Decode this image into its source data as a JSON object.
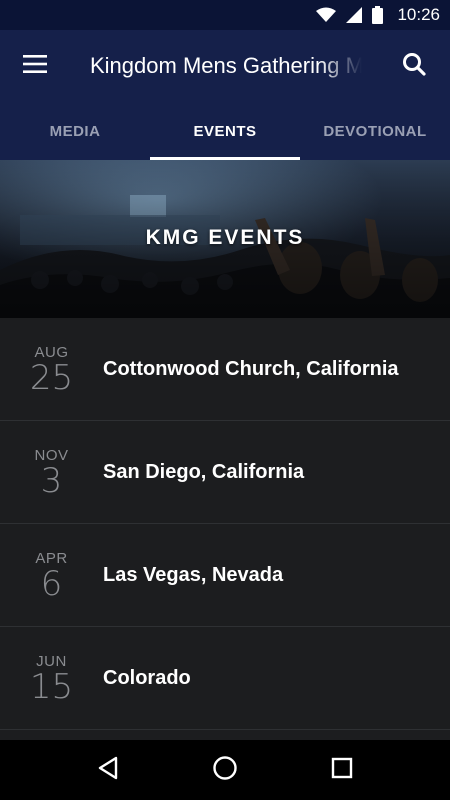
{
  "status_bar": {
    "time": "10:26",
    "icons": [
      "wifi-icon",
      "signal-icon",
      "battery-icon"
    ]
  },
  "app_bar": {
    "title": "Kingdom Mens Gathering Mobile",
    "menu_icon": "hamburger-menu-icon",
    "search_icon": "search-icon"
  },
  "tabs": [
    {
      "label": "MEDIA",
      "active": false
    },
    {
      "label": "EVENTS",
      "active": true
    },
    {
      "label": "DEVOTIONAL",
      "active": false
    }
  ],
  "hero": {
    "title": "KMG EVENTS"
  },
  "events": [
    {
      "month": "AUG",
      "day": "25",
      "name": "Cottonwood Church, California"
    },
    {
      "month": "NOV",
      "day": "3",
      "name": "San Diego, California"
    },
    {
      "month": "APR",
      "day": "6",
      "name": "Las Vegas, Nevada"
    },
    {
      "month": "JUN",
      "day": "15",
      "name": "Colorado"
    }
  ],
  "nav_bar": {
    "icons": [
      "back-icon",
      "home-icon",
      "recents-icon"
    ]
  },
  "colors": {
    "status_bar": "#0b1436",
    "app_bar": "#15204a",
    "list_background": "#1c1d1f",
    "divider": "#2e3033",
    "inactive_tab": "#9aa0b4"
  }
}
